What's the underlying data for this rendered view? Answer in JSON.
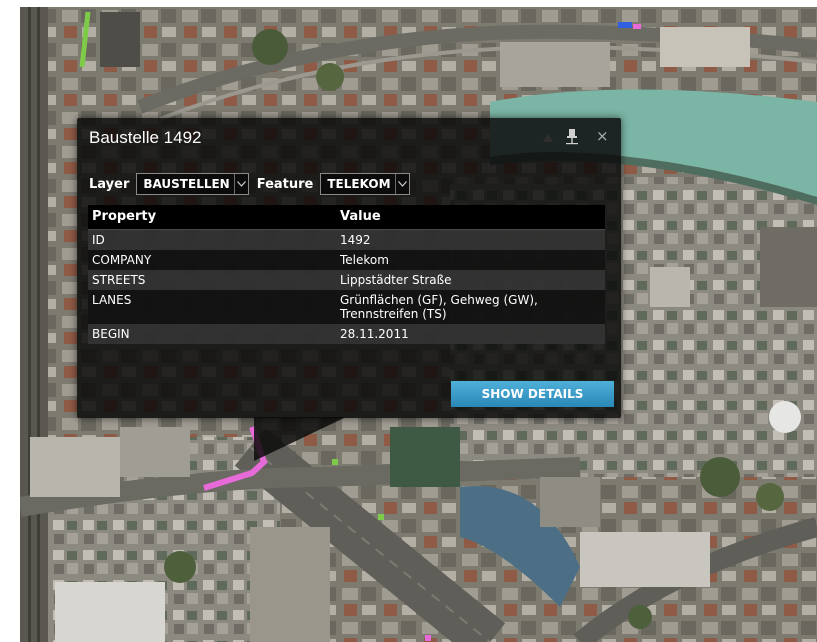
{
  "popup": {
    "title": "Baustelle 1492",
    "layer_label": "Layer",
    "layer_value": "BAUSTELLEN",
    "feature_label": "Feature",
    "feature_value": "TELEKOM",
    "table": {
      "headers": [
        "Property",
        "Value"
      ],
      "rows": [
        {
          "property": "ID",
          "value": "1492"
        },
        {
          "property": "COMPANY",
          "value": "Telekom"
        },
        {
          "property": "STREETS",
          "value": "Lippstädter Straße"
        },
        {
          "property": "LANES",
          "value": "Grünflächen (GF), Gehweg (GW), Trennstreifen (TS)"
        },
        {
          "property": "BEGIN",
          "value": "28.11.2011"
        }
      ]
    },
    "details_button": "SHOW DETAILS",
    "icons": {
      "pin": "pin-icon",
      "close": "close-icon",
      "dim": "dim-icon"
    }
  },
  "map": {
    "layer_colors": {
      "construction": "#e86ad8",
      "highlight": "#7ecb4a",
      "water": "#7ab5a5"
    }
  }
}
